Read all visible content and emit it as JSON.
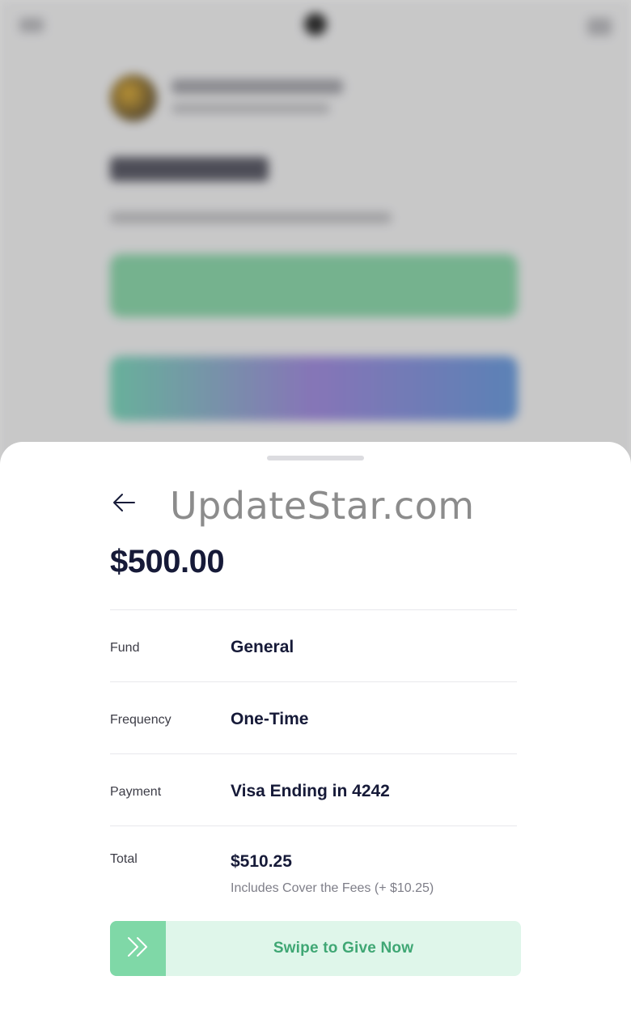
{
  "watermark": "UpdateStar.com",
  "sheet": {
    "amount": "$500.00",
    "rows": [
      {
        "label": "Fund",
        "value": "General"
      },
      {
        "label": "Frequency",
        "value": "One-Time"
      },
      {
        "label": "Payment",
        "value": "Visa Ending in 4242"
      }
    ],
    "total": {
      "label": "Total",
      "value": "$510.25",
      "note": "Includes Cover the Fees (+ $10.25)"
    },
    "swipe_label": "Swipe to Give Now"
  },
  "icons": {
    "back": "arrow-left-icon",
    "swipe": "double-chevron-right-icon"
  },
  "colors": {
    "primary_text": "#161a38",
    "swipe_bg": "#dff6ea",
    "swipe_handle": "#7fd8a7",
    "swipe_text": "#3fa774"
  }
}
